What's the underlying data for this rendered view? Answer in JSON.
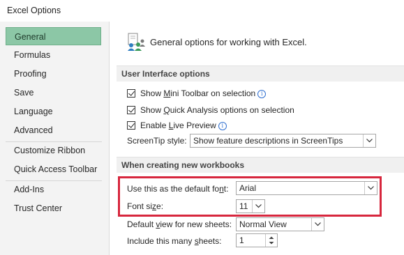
{
  "window": {
    "title": "Excel Options"
  },
  "sidebar": {
    "items": [
      {
        "label": "General",
        "selected": true
      },
      {
        "label": "Formulas"
      },
      {
        "label": "Proofing"
      },
      {
        "label": "Save"
      },
      {
        "label": "Language"
      },
      {
        "label": "Advanced"
      },
      {
        "label": "Customize Ribbon"
      },
      {
        "label": "Quick Access Toolbar"
      },
      {
        "label": "Add-Ins"
      },
      {
        "label": "Trust Center"
      }
    ]
  },
  "main": {
    "header": {
      "icon": "users-options-icon",
      "text": "General options for working with Excel."
    },
    "ui_section": {
      "title": "User Interface options",
      "mini_toolbar": {
        "pre": "Show ",
        "mnemonic": "M",
        "post": "ini Toolbar on selection",
        "checked": true
      },
      "quick_analysis": {
        "pre": "Show ",
        "mnemonic": "Q",
        "post": "uick Analysis options on selection",
        "checked": true
      },
      "live_preview": {
        "pre": "Enable ",
        "mnemonic": "L",
        "post": "ive Preview",
        "checked": true
      },
      "screentip": {
        "label": "ScreenTip style:",
        "value": "Show feature descriptions in ScreenTips"
      }
    },
    "new_wb_section": {
      "title": "When creating new workbooks",
      "default_font": {
        "pre": "Use this as the default fo",
        "mnemonic": "n",
        "post": "t:",
        "value": "Arial"
      },
      "font_size": {
        "pre": "Font si",
        "mnemonic": "z",
        "post": "e:",
        "value": "11"
      },
      "default_view": {
        "pre": "Default ",
        "mnemonic": "v",
        "post": "iew for new sheets:",
        "value": "Normal View"
      },
      "sheets": {
        "pre": "Include this many ",
        "mnemonic": "s",
        "post": "heets:",
        "value": "1"
      }
    }
  },
  "colors": {
    "selected_nav": "#8cc7a6",
    "highlight_box": "#d7263d",
    "section_bg": "#f0f0f0"
  }
}
